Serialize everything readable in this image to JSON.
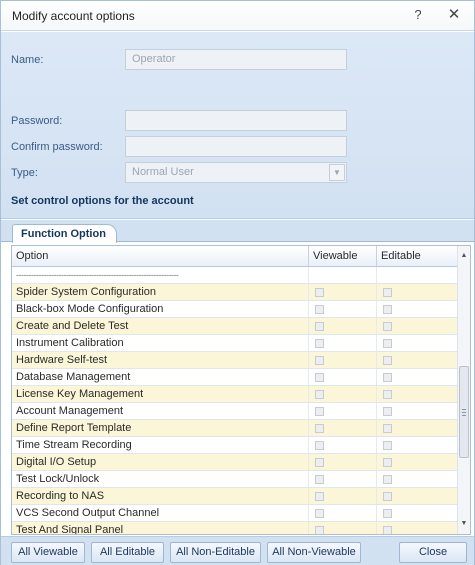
{
  "window": {
    "title": "Modify account options",
    "help_glyph": "?",
    "close_glyph": "✕"
  },
  "form": {
    "name_label": "Name:",
    "name_value": "Operator",
    "password_label": "Password:",
    "password_value": "",
    "confirm_label": "Confirm password:",
    "confirm_value": "",
    "type_label": "Type:",
    "type_value": "Normal User",
    "section_heading": "Set control options for the account"
  },
  "tabs": [
    {
      "label": "Function Option",
      "active": true
    }
  ],
  "grid": {
    "columns": [
      "Option",
      "Viewable",
      "Editable"
    ],
    "separator_text": "-----------------------------------------------------------------",
    "rows": [
      {
        "option": "Spider System Configuration",
        "viewable": false,
        "editable": false
      },
      {
        "option": "Black-box Mode Configuration",
        "viewable": false,
        "editable": false
      },
      {
        "option": "Create and Delete Test",
        "viewable": false,
        "editable": false
      },
      {
        "option": "Instrument Calibration",
        "viewable": false,
        "editable": false
      },
      {
        "option": "Hardware Self-test",
        "viewable": false,
        "editable": false
      },
      {
        "option": "Database Management",
        "viewable": false,
        "editable": false
      },
      {
        "option": "License Key Management",
        "viewable": false,
        "editable": false
      },
      {
        "option": "Account Management",
        "viewable": false,
        "editable": false
      },
      {
        "option": "Define Report Template",
        "viewable": false,
        "editable": false
      },
      {
        "option": "Time Stream Recording",
        "viewable": false,
        "editable": false
      },
      {
        "option": "Digital I/O Setup",
        "viewable": false,
        "editable": false
      },
      {
        "option": "Test Lock/Unlock",
        "viewable": false,
        "editable": false
      },
      {
        "option": "Recording to NAS",
        "viewable": false,
        "editable": false
      },
      {
        "option": "VCS Second Output Channel",
        "viewable": false,
        "editable": false
      },
      {
        "option": "Test And Signal Panel",
        "viewable": false,
        "editable": false
      }
    ]
  },
  "buttons": {
    "all_viewable": "All Viewable",
    "all_editable": "All Editable",
    "all_non_editable": "All Non-Editable",
    "all_non_viewable": "All Non-Viewable",
    "close": "Close"
  },
  "icons": {
    "scroll_up": "chevron-up-icon",
    "scroll_down": "chevron-down-icon",
    "dropdown": "chevron-down-icon"
  },
  "colors": {
    "panel_blue": "#d2e1f2",
    "row_highlight": "#fbf6d8",
    "heading_text": "#15355e"
  }
}
